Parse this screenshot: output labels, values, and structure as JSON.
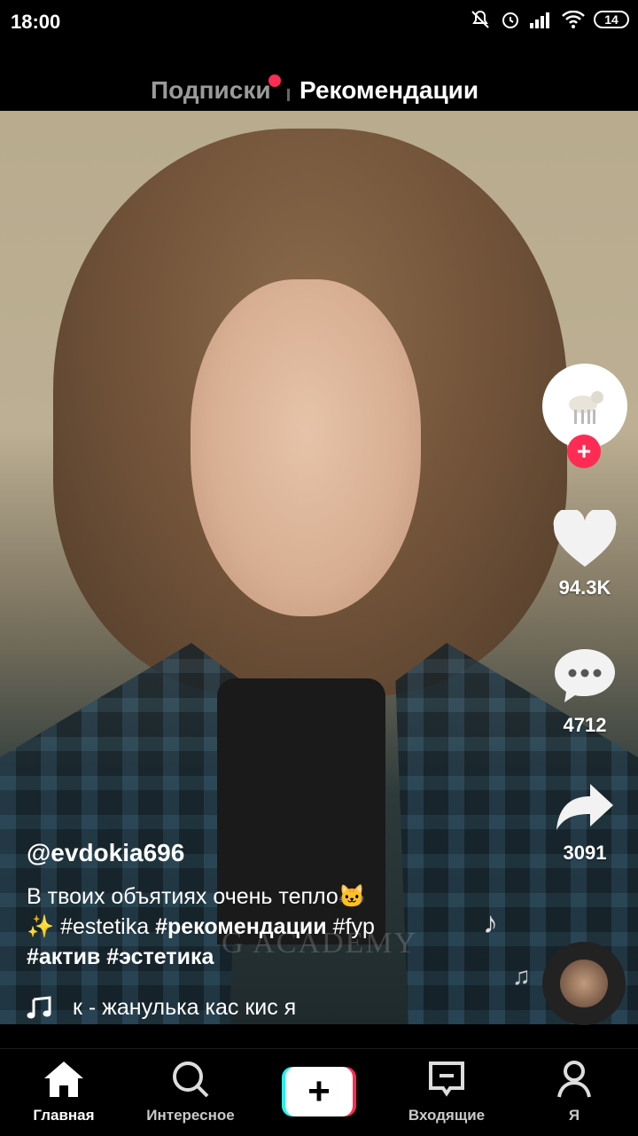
{
  "status_bar": {
    "time": "18:00",
    "battery": "14"
  },
  "tabs": [
    {
      "label": "Подписки"
    },
    {
      "label": "Рекомендации"
    }
  ],
  "actions": {
    "likes": "94.3K",
    "comments": "4712",
    "shares": "3091"
  },
  "post": {
    "username": "@evdokia696",
    "caption_line1": "В твоих объятиях очень тепло🐱",
    "caption_line2_a": "✨ #estetika ",
    "caption_line2_b": "#рекомендации",
    "caption_line2_c": " #fyp",
    "caption_line3": "#актив #эстетика",
    "music": "к - жанулька     кас кис я",
    "watermark": "G ACADEMY"
  },
  "nav": [
    {
      "label": "Главная"
    },
    {
      "label": "Интересное"
    },
    {
      "label": "Входящие"
    },
    {
      "label": "Я"
    }
  ],
  "colors": {
    "accent": "#fe2c55",
    "cyan": "#25f4ee"
  }
}
